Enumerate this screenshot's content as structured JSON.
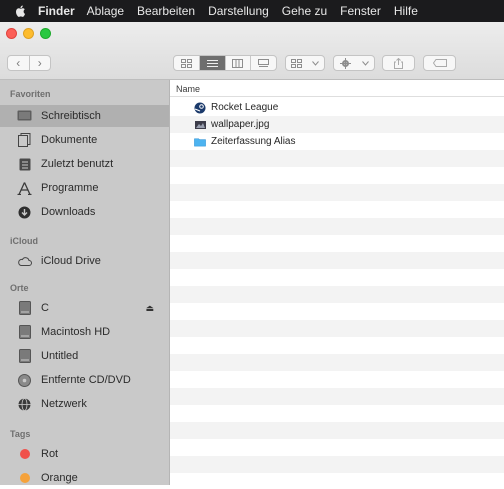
{
  "menubar": {
    "app_name": "Finder",
    "items": [
      "Ablage",
      "Bearbeiten",
      "Darstellung",
      "Gehe zu",
      "Fenster",
      "Hilfe"
    ]
  },
  "toolbar": {
    "back_label": "‹",
    "forward_label": "›"
  },
  "sidebar": {
    "sections": {
      "favorites": "Favoriten",
      "icloud": "iCloud",
      "locations": "Orte",
      "tags": "Tags"
    },
    "favorites": [
      {
        "label": "Schreibtisch",
        "icon": "desktop-icon",
        "selected": true
      },
      {
        "label": "Dokumente",
        "icon": "documents-icon"
      },
      {
        "label": "Zuletzt benutzt",
        "icon": "recents-icon"
      },
      {
        "label": "Programme",
        "icon": "applications-icon"
      },
      {
        "label": "Downloads",
        "icon": "downloads-icon"
      }
    ],
    "icloud": [
      {
        "label": "iCloud Drive",
        "icon": "cloud-icon"
      }
    ],
    "locations": [
      {
        "label": "C",
        "icon": "drive-icon",
        "eject": "⏏"
      },
      {
        "label": "Macintosh HD",
        "icon": "drive-icon"
      },
      {
        "label": "Untitled",
        "icon": "drive-icon"
      },
      {
        "label": "Entfernte CD/DVD",
        "icon": "disc-icon"
      },
      {
        "label": "Netzwerk",
        "icon": "network-icon"
      }
    ],
    "tags": [
      {
        "label": "Rot",
        "color": "#f0504a"
      },
      {
        "label": "Orange",
        "color": "#f5a23b"
      }
    ]
  },
  "content": {
    "column_name": "Name",
    "files": [
      {
        "name": "Rocket League",
        "icon": "steam-icon"
      },
      {
        "name": "wallpaper.jpg",
        "icon": "image-file-icon"
      },
      {
        "name": "Zeiterfassung Alias",
        "icon": "folder-icon"
      }
    ]
  }
}
